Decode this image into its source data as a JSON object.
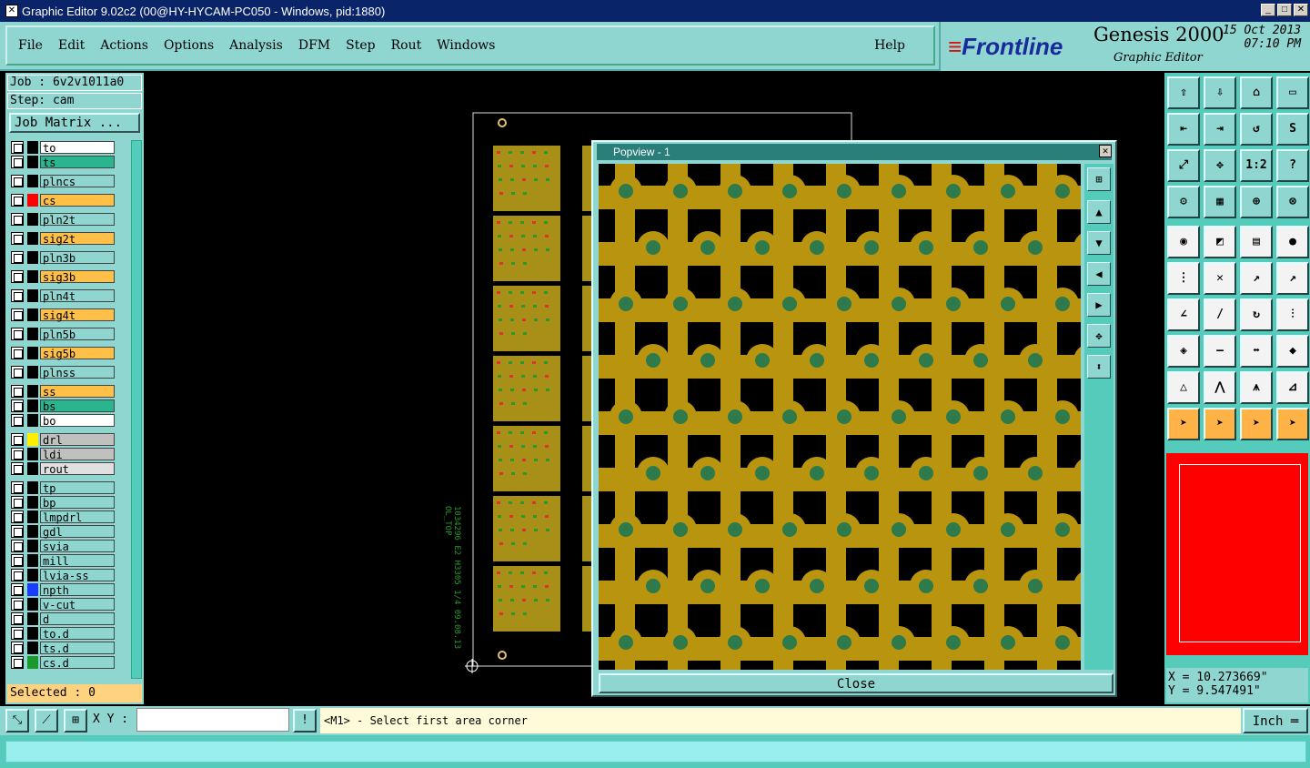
{
  "window": {
    "title": "Graphic Editor 9.02c2 (00@HY-HYCAM-PC050 - Windows, pid:1880)"
  },
  "menus": [
    "File",
    "Edit",
    "Actions",
    "Options",
    "Analysis",
    "DFM",
    "Step",
    "Rout",
    "Windows"
  ],
  "help_label": "Help",
  "brand": {
    "logo": "Frontline",
    "product": "Genesis 2000",
    "subtitle": "Graphic Editor",
    "date": "15 Oct 2013",
    "time": "07:10 PM"
  },
  "job": {
    "job_label": "Job : 6v2v1011a0",
    "step_label": "Step: cam",
    "matrix_button": "Job Matrix ..."
  },
  "layers": [
    {
      "name": "to",
      "color": "#ffffff",
      "swatch": ""
    },
    {
      "name": "ts",
      "color": "#2bb58f",
      "swatch": ""
    },
    {
      "name": "plncs",
      "color": "#8fd5d0",
      "swatch": ""
    },
    {
      "name": "cs",
      "color": "#ffc04a",
      "swatch": "#ff0000"
    },
    {
      "name": "pln2t",
      "color": "#8fd5d0",
      "swatch": ""
    },
    {
      "name": "sig2t",
      "color": "#ffc04a",
      "swatch": ""
    },
    {
      "name": "pln3b",
      "color": "#8fd5d0",
      "swatch": ""
    },
    {
      "name": "sig3b",
      "color": "#ffc04a",
      "swatch": ""
    },
    {
      "name": "pln4t",
      "color": "#8fd5d0",
      "swatch": ""
    },
    {
      "name": "sig4t",
      "color": "#ffc04a",
      "swatch": ""
    },
    {
      "name": "pln5b",
      "color": "#8fd5d0",
      "swatch": ""
    },
    {
      "name": "sig5b",
      "color": "#ffc04a",
      "swatch": ""
    },
    {
      "name": "plnss",
      "color": "#8fd5d0",
      "swatch": ""
    },
    {
      "name": "ss",
      "color": "#ffc04a",
      "swatch": ""
    },
    {
      "name": "bs",
      "color": "#2bb58f",
      "swatch": ""
    },
    {
      "name": "bo",
      "color": "#ffffff",
      "swatch": ""
    },
    {
      "name": "drl",
      "color": "#c0c0c0",
      "swatch": "#ffee00"
    },
    {
      "name": "ldi",
      "color": "#c0c0c0",
      "swatch": ""
    },
    {
      "name": "rout",
      "color": "#e0e0e0",
      "swatch": ""
    },
    {
      "name": "tp",
      "color": "#8fd5d0",
      "swatch": ""
    },
    {
      "name": "bp",
      "color": "#8fd5d0",
      "swatch": ""
    },
    {
      "name": "lmpdrl",
      "color": "#8fd5d0",
      "swatch": ""
    },
    {
      "name": "gdl",
      "color": "#8fd5d0",
      "swatch": ""
    },
    {
      "name": "svia",
      "color": "#8fd5d0",
      "swatch": ""
    },
    {
      "name": "mill",
      "color": "#8fd5d0",
      "swatch": ""
    },
    {
      "name": "lvia-ss",
      "color": "#8fd5d0",
      "swatch": ""
    },
    {
      "name": "npth",
      "color": "#8fd5d0",
      "swatch": "#1a3cff"
    },
    {
      "name": "v-cut",
      "color": "#8fd5d0",
      "swatch": ""
    },
    {
      "name": "d",
      "color": "#8fd5d0",
      "swatch": ""
    },
    {
      "name": "to.d",
      "color": "#8fd5d0",
      "swatch": ""
    },
    {
      "name": "ts.d",
      "color": "#8fd5d0",
      "swatch": ""
    },
    {
      "name": "cs.d",
      "color": "#8fd5d0",
      "swatch": "#1a9a2a"
    }
  ],
  "selected_label": "Selected : 0",
  "popview": {
    "title": "Popview - 1",
    "close_label": "Close"
  },
  "coords": {
    "x": "X = 10.273669\"",
    "y": "Y = 9.547491\""
  },
  "statusbar": {
    "xy_label": "X Y :",
    "xy_value": "",
    "prompt": "<M1> - Select first area corner",
    "unit": "Inch"
  },
  "canvas_text": {
    "vertical_label": "1034296 E2 H3305 1/4 09.08.13",
    "side_label": "OL_TOP"
  }
}
